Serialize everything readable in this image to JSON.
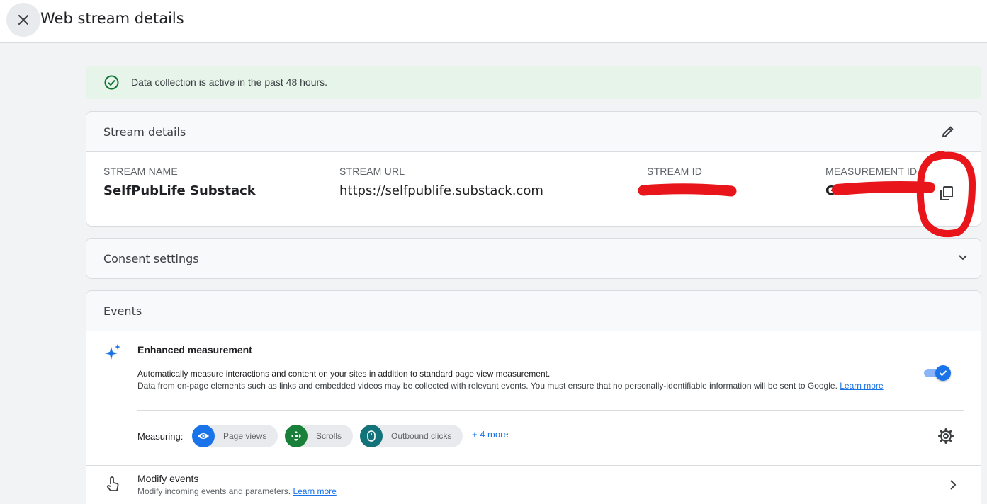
{
  "header": {
    "title": "Web stream details"
  },
  "banner": {
    "text": "Data collection is active in the past 48 hours."
  },
  "stream_details": {
    "title": "Stream details",
    "fields": [
      {
        "label": "STREAM NAME",
        "value": "SelfPubLife Substack"
      },
      {
        "label": "STREAM URL",
        "value": "https://selfpublife.substack.com"
      },
      {
        "label": "STREAM ID",
        "value": ""
      },
      {
        "label": "MEASUREMENT ID",
        "value": "G-"
      }
    ]
  },
  "consent": {
    "title": "Consent settings"
  },
  "events": {
    "title": "Events",
    "enhanced": {
      "title": "Enhanced measurement",
      "desc1": "Automatically measure interactions and content on your sites in addition to standard page view measurement.",
      "desc2": "Data from on-page elements such as links and embedded videos may be collected with relevant events. You must ensure that no personally-identifiable information will be sent to Google.",
      "learn_more": "Learn more",
      "enabled": true
    },
    "measuring_label": "Measuring:",
    "chips": [
      "Page views",
      "Scrolls",
      "Outbound clicks"
    ],
    "more": "+ 4 more",
    "modify": {
      "title": "Modify events",
      "desc": "Modify incoming events and parameters.",
      "learn_more": "Learn more"
    }
  },
  "colors": {
    "accent": "#1a73e8",
    "success": "#137333",
    "annotation": "#e8161a"
  },
  "icons": [
    "close-icon",
    "check-circle-icon",
    "edit-icon",
    "copy-icon",
    "chevron-down-icon",
    "sparkle-icon",
    "gear-icon",
    "touch-icon",
    "chevron-right-icon",
    "eye-icon",
    "scroll-icon",
    "mouse-icon"
  ]
}
